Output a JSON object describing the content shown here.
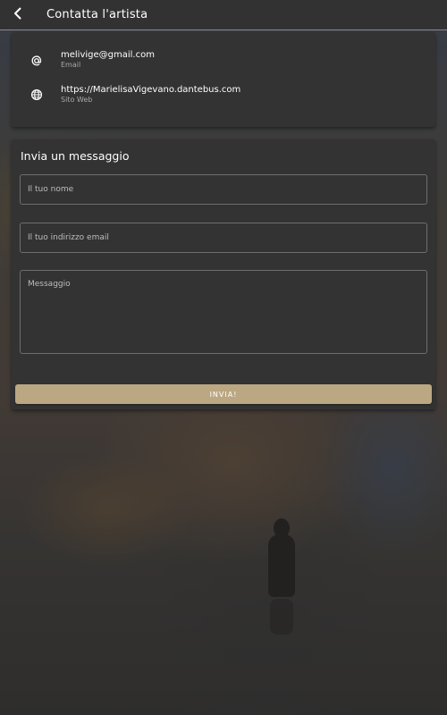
{
  "appbar": {
    "title": "Contatta l'artista",
    "back_icon": "arrow-back-icon"
  },
  "contact_info": {
    "items": [
      {
        "icon": "at-icon",
        "value": "melivige@gmail.com",
        "label": "Email"
      },
      {
        "icon": "globe-icon",
        "value": "https://MarielisaVigevano.dantebus.com",
        "label": "Sito Web"
      }
    ]
  },
  "form": {
    "title": "Invia un messaggio",
    "name_placeholder": "Il tuo nome",
    "email_placeholder": "Il tuo indirizzo email",
    "message_placeholder": "Messaggio",
    "name_value": "",
    "email_value": "",
    "message_value": "",
    "submit_label": "INVIA!"
  },
  "colors": {
    "appbar_bg": "#323232",
    "card_bg": "#333333",
    "accent_button": "#bba781",
    "text_primary": "#ffffff",
    "text_secondary": "#a8a8a8"
  }
}
